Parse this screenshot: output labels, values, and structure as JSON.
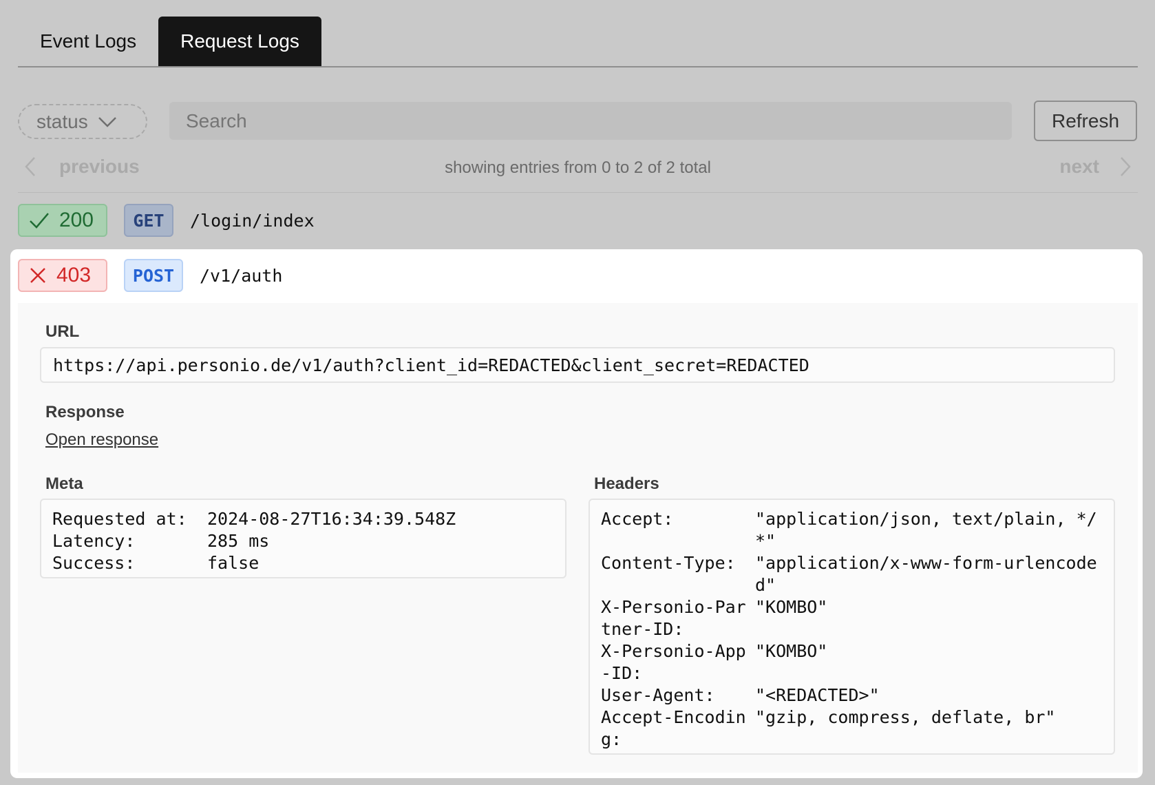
{
  "tabs": [
    {
      "label": "Event Logs",
      "active": false
    },
    {
      "label": "Request Logs",
      "active": true
    }
  ],
  "filters": {
    "status_label": "status",
    "search_placeholder": "Search",
    "refresh_label": "Refresh"
  },
  "pagination": {
    "previous_label": "previous",
    "next_label": "next",
    "info": "showing entries from 0 to 2 of 2 total"
  },
  "logs": [
    {
      "status": "200",
      "status_kind": "success",
      "method": "GET",
      "path": "/login/index"
    },
    {
      "status": "403",
      "status_kind": "error",
      "method": "POST",
      "path": "/v1/auth"
    }
  ],
  "detail": {
    "url_label": "URL",
    "url": "https://api.personio.de/v1/auth?client_id=REDACTED&client_secret=REDACTED",
    "response_label": "Response",
    "open_response_label": "Open response",
    "meta_label": "Meta",
    "meta": [
      {
        "key": "Requested at:",
        "value": "2024-08-27T16:34:39.548Z"
      },
      {
        "key": "Latency:",
        "value": "285 ms"
      },
      {
        "key": "Success:",
        "value": "false"
      }
    ],
    "headers_label": "Headers",
    "headers": [
      {
        "key": "Accept:",
        "value": "\"application/json, text/plain, */*\""
      },
      {
        "key": "Content-Type:",
        "value": "\"application/x-www-form-urlencoded\""
      },
      {
        "key": "X-Personio-Partner-ID:",
        "value": "\"KOMBO\""
      },
      {
        "key": "X-Personio-App-ID:",
        "value": "\"KOMBO\""
      },
      {
        "key": "User-Agent:",
        "value": "\"<REDACTED>\""
      },
      {
        "key": "Accept-Encoding:",
        "value": "\"gzip, compress, deflate, br\""
      }
    ]
  },
  "colors": {
    "success": "#1f6b33",
    "error": "#d22727",
    "method_get": "#27417a",
    "method_post": "#2563d4"
  }
}
